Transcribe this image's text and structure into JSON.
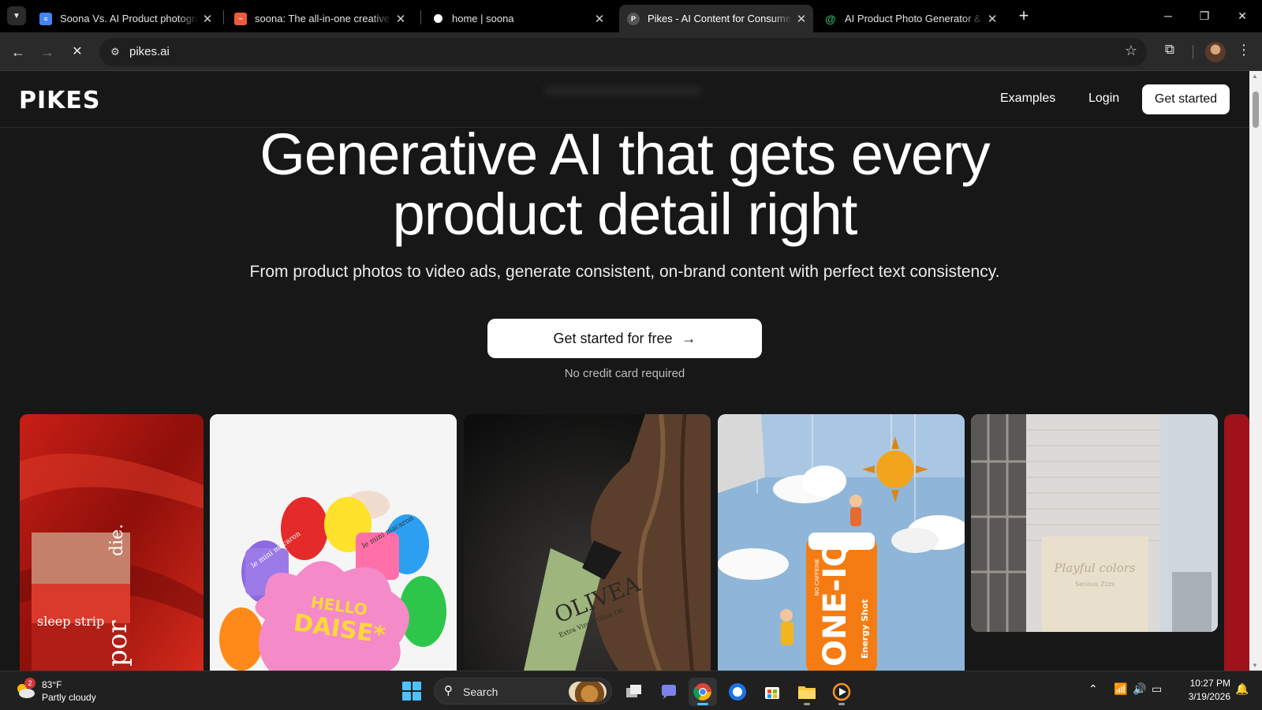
{
  "browser": {
    "tabs": [
      {
        "title": "Soona Vs. AI Product photography",
        "favicon": "docs-icon",
        "color": "#4285f4",
        "active": false
      },
      {
        "title": "soona: The all-in-one creative platform",
        "favicon": "soona-icon",
        "color": "#f05a3c",
        "active": false
      },
      {
        "title": "home | soona",
        "favicon": "soona-dot-icon",
        "color": "#ffffff",
        "active": false
      },
      {
        "title": "Pikes - AI Content for Consumer Brands",
        "favicon": "pikes-icon",
        "color": "#3b3b3b",
        "active": true
      },
      {
        "title": "AI Product Photo Generator & Editor",
        "favicon": "swirl-icon",
        "color": "#2bb673",
        "active": false
      }
    ],
    "url": "pikes.ai"
  },
  "site": {
    "logo": "PIKES",
    "nav": {
      "examples": "Examples",
      "login": "Login",
      "cta": "Get started"
    },
    "hero": {
      "title_line1": "Generative AI that gets every",
      "title_line2": "product detail right",
      "subtitle": "From product photos to video ads, generate consistent, on-brand content with perfect text consistency.",
      "cta": "Get started for free",
      "note": "No credit card required"
    },
    "gallery": {
      "card1": {
        "brand": "die.",
        "label": "sleep strip",
        "side": "por"
      },
      "card2": {
        "line1": "HELLO",
        "line2": "DAISE*",
        "pill1": "le mini macaron",
        "pill2": "le mini macaron"
      },
      "card3": {
        "brand": "OLIVEA",
        "sub": "Extra Virgin Olive Oil"
      },
      "card4": {
        "brand": "ONE-IQ",
        "sub": "Energy Shot",
        "tag": "NO CAFFEINE"
      },
      "card5": {
        "line1": "Playful colors",
        "line2": "Serious Zzzs"
      }
    }
  },
  "taskbar": {
    "weather": {
      "badge": "2",
      "temp": "83°F",
      "condition": "Partly cloudy"
    },
    "search": "Search",
    "time": "10:27 PM",
    "date": "3/19/2026"
  },
  "colors": {
    "accent": "#4cc2ff",
    "page_bg": "#171717",
    "cta_bg": "#ffffff"
  }
}
